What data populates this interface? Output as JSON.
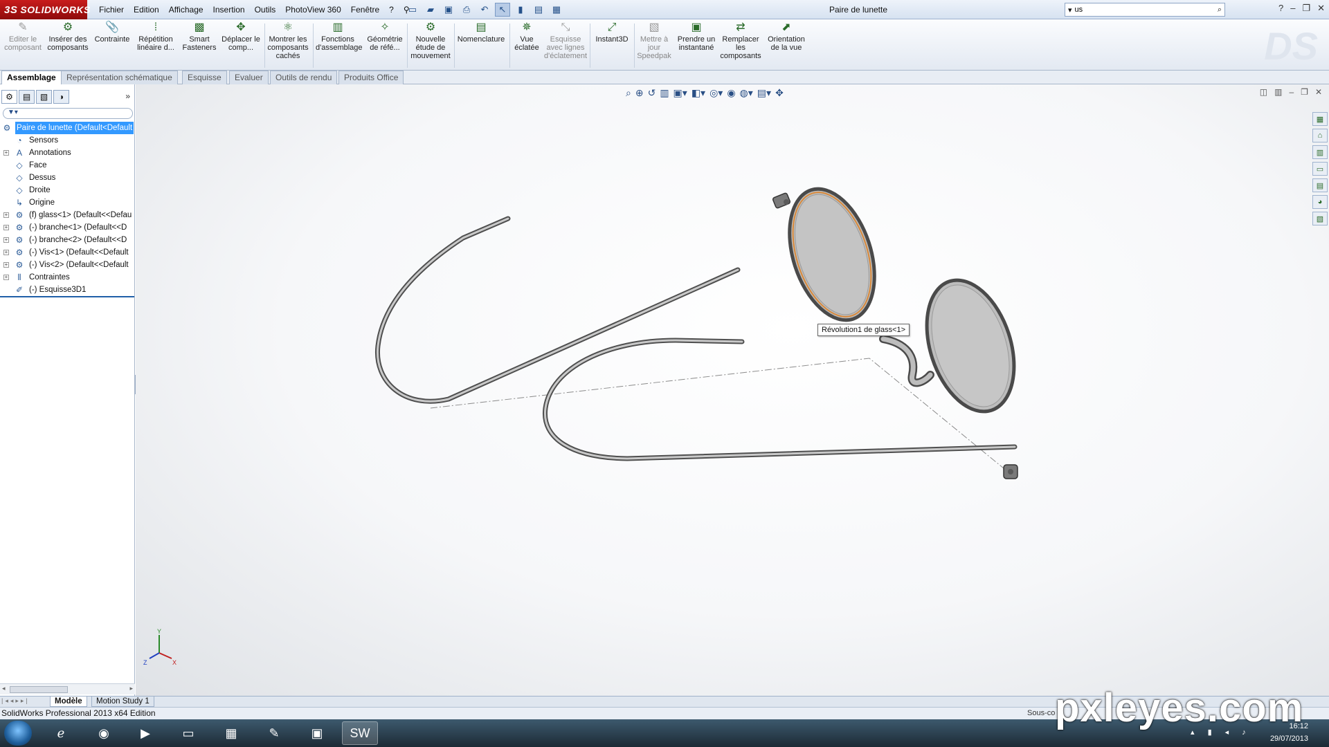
{
  "app": {
    "logo_prefix": "3S",
    "logo_text": "SOLIDWORKS",
    "document_title": "Paire de lunette"
  },
  "menu": [
    "Fichier",
    "Edition",
    "Affichage",
    "Insertion",
    "Outils",
    "PhotoView 360",
    "Fenêtre",
    "?"
  ],
  "search": {
    "value": "us",
    "placeholder": ""
  },
  "command_manager": [
    {
      "label": "Editer le composant",
      "icon": "edit-component-icon",
      "disabled": true
    },
    {
      "label": "Insérer des composants",
      "icon": "insert-components-icon",
      "disabled": false
    },
    {
      "label": "Contrainte",
      "icon": "mate-icon",
      "disabled": false
    },
    {
      "label": "Répétition linéaire d...",
      "icon": "linear-pattern-icon",
      "disabled": false
    },
    {
      "label": "Smart Fasteners",
      "icon": "smart-fasteners-icon",
      "disabled": false
    },
    {
      "label": "Déplacer le comp...",
      "icon": "move-component-icon",
      "disabled": false
    },
    {
      "label": "Montrer les composants cachés",
      "icon": "show-hidden-icon",
      "disabled": false
    },
    {
      "label": "Fonctions d'assemblage",
      "icon": "assembly-features-icon",
      "disabled": false
    },
    {
      "label": "Géométrie de réfé...",
      "icon": "reference-geometry-icon",
      "disabled": false
    },
    {
      "label": "Nouvelle étude de mouvement",
      "icon": "motion-study-icon",
      "disabled": false
    },
    {
      "label": "Nomenclature",
      "icon": "bom-icon",
      "disabled": false
    },
    {
      "label": "Vue éclatée",
      "icon": "exploded-view-icon",
      "disabled": false
    },
    {
      "label": "Esquisse avec lignes d'éclatement",
      "icon": "explode-line-sketch-icon",
      "disabled": true
    },
    {
      "label": "Instant3D",
      "icon": "instant3d-icon",
      "disabled": false
    },
    {
      "label": "Mettre à jour Speedpak",
      "icon": "speedpak-icon",
      "disabled": true
    },
    {
      "label": "Prendre un instantané",
      "icon": "snapshot-icon",
      "disabled": false
    },
    {
      "label": "Remplacer les composants",
      "icon": "replace-components-icon",
      "disabled": false
    },
    {
      "label": "Orientation de la vue",
      "icon": "view-orientation-icon",
      "disabled": false
    }
  ],
  "command_tabs": [
    "Assemblage",
    "Représentation schématique",
    "Esquisse",
    "Evaluer",
    "Outils de rendu",
    "Produits Office"
  ],
  "active_command_tab": "Assemblage",
  "feature_tree": {
    "root": "Paire de lunette  (Default<Default",
    "items": [
      {
        "label": "Sensors",
        "icon": "sensors-icon",
        "expandable": false
      },
      {
        "label": "Annotations",
        "icon": "annotations-icon",
        "expandable": true
      },
      {
        "label": "Face",
        "icon": "plane-icon",
        "expandable": false
      },
      {
        "label": "Dessus",
        "icon": "plane-icon",
        "expandable": false
      },
      {
        "label": "Droite",
        "icon": "plane-icon",
        "expandable": false
      },
      {
        "label": "Origine",
        "icon": "origin-icon",
        "expandable": false
      },
      {
        "label": "(f) glass<1> (Default<<Defau",
        "icon": "part-icon",
        "expandable": true
      },
      {
        "label": "(-) branche<1> (Default<<D",
        "icon": "part-icon",
        "expandable": true
      },
      {
        "label": "(-) branche<2> (Default<<D",
        "icon": "part-icon",
        "expandable": true
      },
      {
        "label": "(-) Vis<1> (Default<<Default",
        "icon": "part-icon",
        "expandable": true
      },
      {
        "label": "(-) Vis<2> (Default<<Default",
        "icon": "part-icon",
        "expandable": true
      },
      {
        "label": "Contraintes",
        "icon": "mates-icon",
        "expandable": true
      },
      {
        "label": "(-) Esquisse3D1",
        "icon": "sketch3d-icon",
        "expandable": false
      }
    ]
  },
  "tooltip": "Révolution1 de glass<1>",
  "triad_axes": {
    "y": "Y",
    "z": "Z",
    "x": "X"
  },
  "bottom_tabs": [
    "Modèle",
    "Motion Study 1"
  ],
  "active_bottom_tab": "Modèle",
  "status": {
    "left": "SolidWorks Professional 2013 x64 Edition",
    "right": "Sous-co"
  },
  "tray": {
    "time": "16:12",
    "date": "29/07/2013"
  },
  "watermark": "pxleyes.com",
  "colors": {
    "accent": "#3399ff",
    "brand_red": "#c81c1c",
    "selection_edge": "#d9893a",
    "lens": "#bdbdbd",
    "frame": "#6f6f6f"
  }
}
